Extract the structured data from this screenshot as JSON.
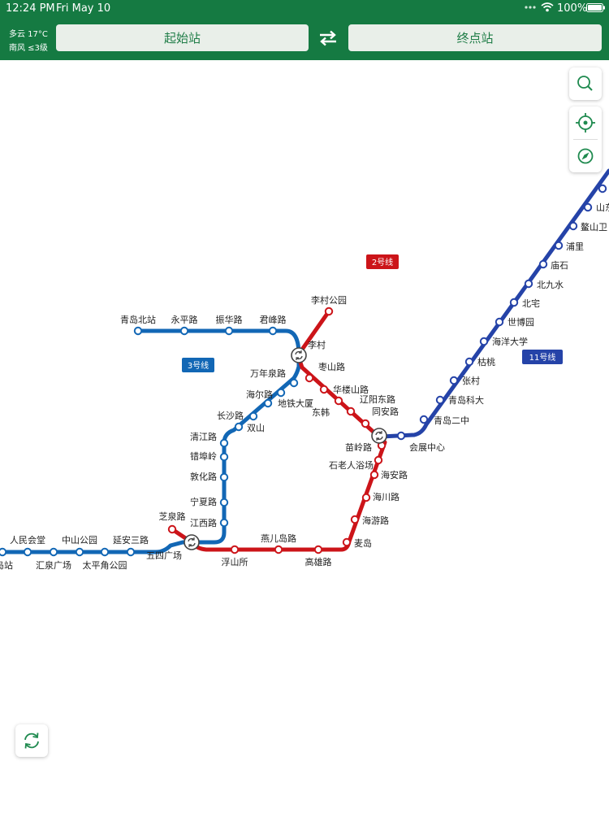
{
  "status_bar": {
    "time": "12:24 PM",
    "date": "Fri May 10",
    "battery": "100%"
  },
  "weather": {
    "condition": "多云 17°C",
    "wind": "南风 ≤3级"
  },
  "header": {
    "start_station": "起始站",
    "end_station": "终点站"
  },
  "lines": [
    {
      "name": "2号线",
      "color": "#cc1419"
    },
    {
      "name": "3号线",
      "color": "#1267b5"
    },
    {
      "name": "11号线",
      "color": "#2543a8"
    }
  ],
  "stations": [
    "青岛北站",
    "永平路",
    "振华路",
    "君峰路",
    "李村公园",
    "李村",
    "万年泉路",
    "枣山路",
    "海尔路",
    "地铁大厦",
    "华楼山路",
    "辽阳东路",
    "东韩",
    "同安路",
    "长沙路",
    "双山",
    "清江路",
    "错埠岭",
    "敦化路",
    "宁夏路",
    "江西路",
    "芝泉路",
    "五四广场",
    "浮山所",
    "燕儿岛路",
    "高雄路",
    "麦岛",
    "海游路",
    "海川路",
    "海安路",
    "石老人浴场",
    "苗岭路",
    "会展中心",
    "青岛二中",
    "青岛科大",
    "张村",
    "枯桃",
    "海洋大学",
    "世博园",
    "北宅",
    "北九水",
    "庙石",
    "浦里",
    "鳌山卫",
    "山东",
    "人民会堂",
    "中山公园",
    "延安三路",
    "汇泉广场",
    "太平角公园",
    "岛站"
  ],
  "map_controls": {
    "search": "search-icon",
    "locate": "crosshair-icon",
    "compass": "compass-icon",
    "refresh": "refresh-icon"
  },
  "colors": {
    "header_bg": "#157a42",
    "button_bg": "#e9efe9",
    "button_text": "#1f7d47"
  }
}
